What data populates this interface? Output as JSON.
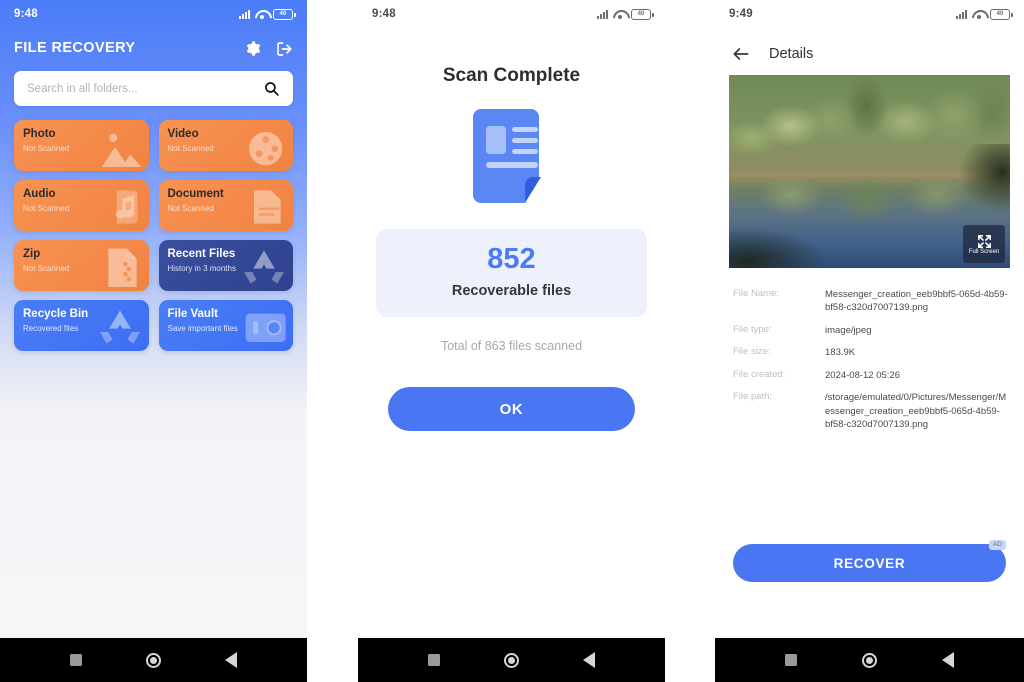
{
  "screens": [
    {
      "id": "home",
      "status": {
        "time": "9:48",
        "battery": "40",
        "signal_icon": "signal-bars-icon",
        "wifi_icon": "wifi-icon",
        "battery_icon": "battery-icon"
      },
      "header": {
        "title": "FILE RECOVERY",
        "settings_icon": "gear-icon",
        "logout_icon": "logout-icon"
      },
      "search": {
        "placeholder": "Search in all folders...",
        "value": "",
        "icon": "search-icon"
      },
      "tiles": [
        {
          "title": "Photo",
          "subtitle": "Not Scanned",
          "style": "orange",
          "icon": "image-icon"
        },
        {
          "title": "Video",
          "subtitle": "Not Scanned",
          "style": "orange",
          "icon": "film-reel-icon"
        },
        {
          "title": "Audio",
          "subtitle": "Not Scanned",
          "style": "orange",
          "icon": "music-note-icon"
        },
        {
          "title": "Document",
          "subtitle": "Not Scanned",
          "style": "orange",
          "icon": "document-icon"
        },
        {
          "title": "Zip",
          "subtitle": "Not Scanned",
          "style": "orange",
          "icon": "zip-file-icon"
        },
        {
          "title": "Recent Files",
          "subtitle": "History in 3 months",
          "style": "navy",
          "icon": "recycle-arrows-icon"
        },
        {
          "title": "Recycle Bin",
          "subtitle": "Recovered files",
          "style": "blue",
          "icon": "recycle-arrows-icon"
        },
        {
          "title": "File Vault",
          "subtitle": "Save important files",
          "style": "blue",
          "icon": "safe-vault-icon"
        }
      ]
    },
    {
      "id": "scan-complete",
      "status": {
        "time": "9:48",
        "battery": "40"
      },
      "title": "Scan Complete",
      "doc_icon": "document-icon",
      "count": "852",
      "count_label": "Recoverable files",
      "total_text": "Total of 863 files scanned",
      "ok_label": "OK"
    },
    {
      "id": "details",
      "status": {
        "time": "9:49",
        "battery": "40"
      },
      "appbar": {
        "back_icon": "back-arrow-icon",
        "title": "Details"
      },
      "preview": {
        "fullscreen_label": "Full Screen",
        "fullscreen_icon": "expand-icon"
      },
      "fields": [
        {
          "label": "File Name:",
          "value": "Messenger_creation_eeb9bbf5-065d-4b59-bf58-c320d7007139.png"
        },
        {
          "label": "File type:",
          "value": "image/jpeg"
        },
        {
          "label": "File size:",
          "value": "183.9K"
        },
        {
          "label": "File created:",
          "value": "2024-08-12 05:26"
        },
        {
          "label": "File path:",
          "value": "/storage/emulated/0/Pictures/Messenger/Messenger_creation_eeb9bbf5-065d-4b59-bf58-c320d7007139.png"
        }
      ],
      "recover_label": "RECOVER",
      "ad_label": "AD"
    }
  ],
  "navbar": {
    "recents_icon": "square-icon",
    "home_icon": "circle-icon",
    "back_icon": "triangle-back-icon"
  },
  "colors": {
    "accent_blue": "#4a76f3",
    "tile_orange": "#f4894a",
    "tile_navy": "#2f418f",
    "tile_blue": "#3c6ef2",
    "count_blue": "#4a7ef0",
    "card_bg": "#eef1fb"
  }
}
